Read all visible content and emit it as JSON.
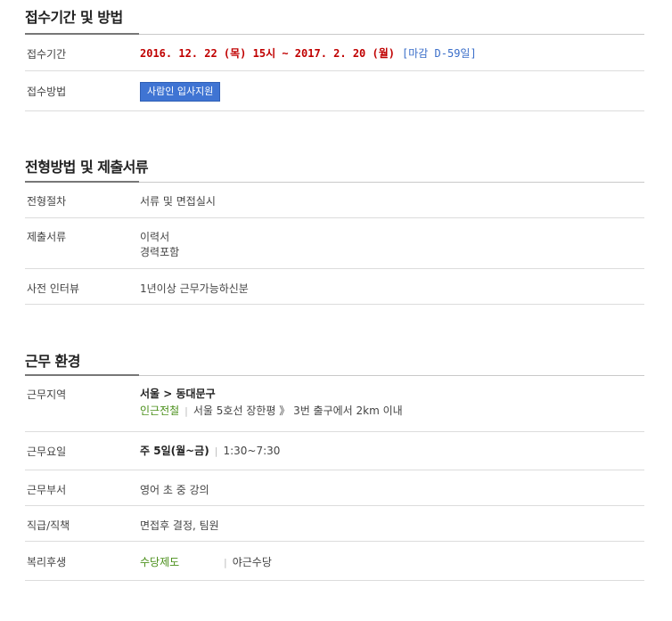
{
  "reception": {
    "title": "접수기간 및 방법",
    "period_label": "접수기간",
    "period_dates": "2016. 12. 22 (목) 15시 ~ 2017. 2. 20 (월)",
    "period_dday": "[마감 D-59일]",
    "method_label": "접수방법",
    "method_button": "사람인 입사지원"
  },
  "selection": {
    "title": "전형방법 및 제출서류",
    "process_label": "전형절차",
    "process_value": "서류 및 면접실시",
    "docs_label": "제출서류",
    "docs_line1": "이력서",
    "docs_line2": "경력포함",
    "interview_label": "사전 인터뷰",
    "interview_value": "1년이상 근무가능하신분"
  },
  "environment": {
    "title": "근무 환경",
    "area_label": "근무지역",
    "area_region": "서울 > 동대문구",
    "area_tag": "인근전철",
    "area_station": "서울 5호선 장한평 》 3번 출구에서 2km 이내",
    "days_label": "근무요일",
    "days_value": "주 5일(월~금)",
    "days_hours": "1:30~7:30",
    "dept_label": "근무부서",
    "dept_value": "영어 초 중 강의",
    "rank_label": "직급/직책",
    "rank_value": "면접후 결정, 팀원",
    "welfare_label": "복리후생",
    "welfare_tag": "수당제도",
    "welfare_value": "야근수당"
  }
}
